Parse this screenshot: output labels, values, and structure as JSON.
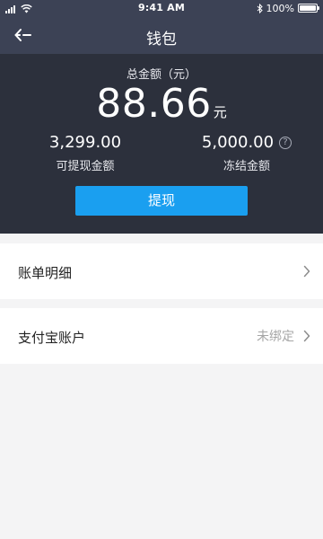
{
  "status_bar": {
    "time": "9:41 AM",
    "battery_text": "100%",
    "battery_level": 1.0,
    "icons": [
      "signal-icon",
      "wifi-icon",
      "bluetooth-icon",
      "battery-icon"
    ]
  },
  "nav": {
    "title": "钱包",
    "back_icon": "back-arrow-icon"
  },
  "balance": {
    "total_label": "总金额（元）",
    "total_amount": "88.66",
    "total_unit": "元",
    "withdrawable_amount": "3,299.00",
    "withdrawable_label": "可提现金额",
    "frozen_amount": "5,000.00",
    "frozen_label": "冻结金额",
    "help_glyph": "?"
  },
  "actions": {
    "withdraw_label": "提现"
  },
  "list": {
    "bill_label": "账单明细",
    "alipay_label": "支付宝账户",
    "alipay_status": "未绑定"
  },
  "colors": {
    "header_bg": "#3c4255",
    "panel_bg": "#2c303c",
    "accent": "#1a9ff0",
    "page_bg": "#f4f4f5"
  }
}
